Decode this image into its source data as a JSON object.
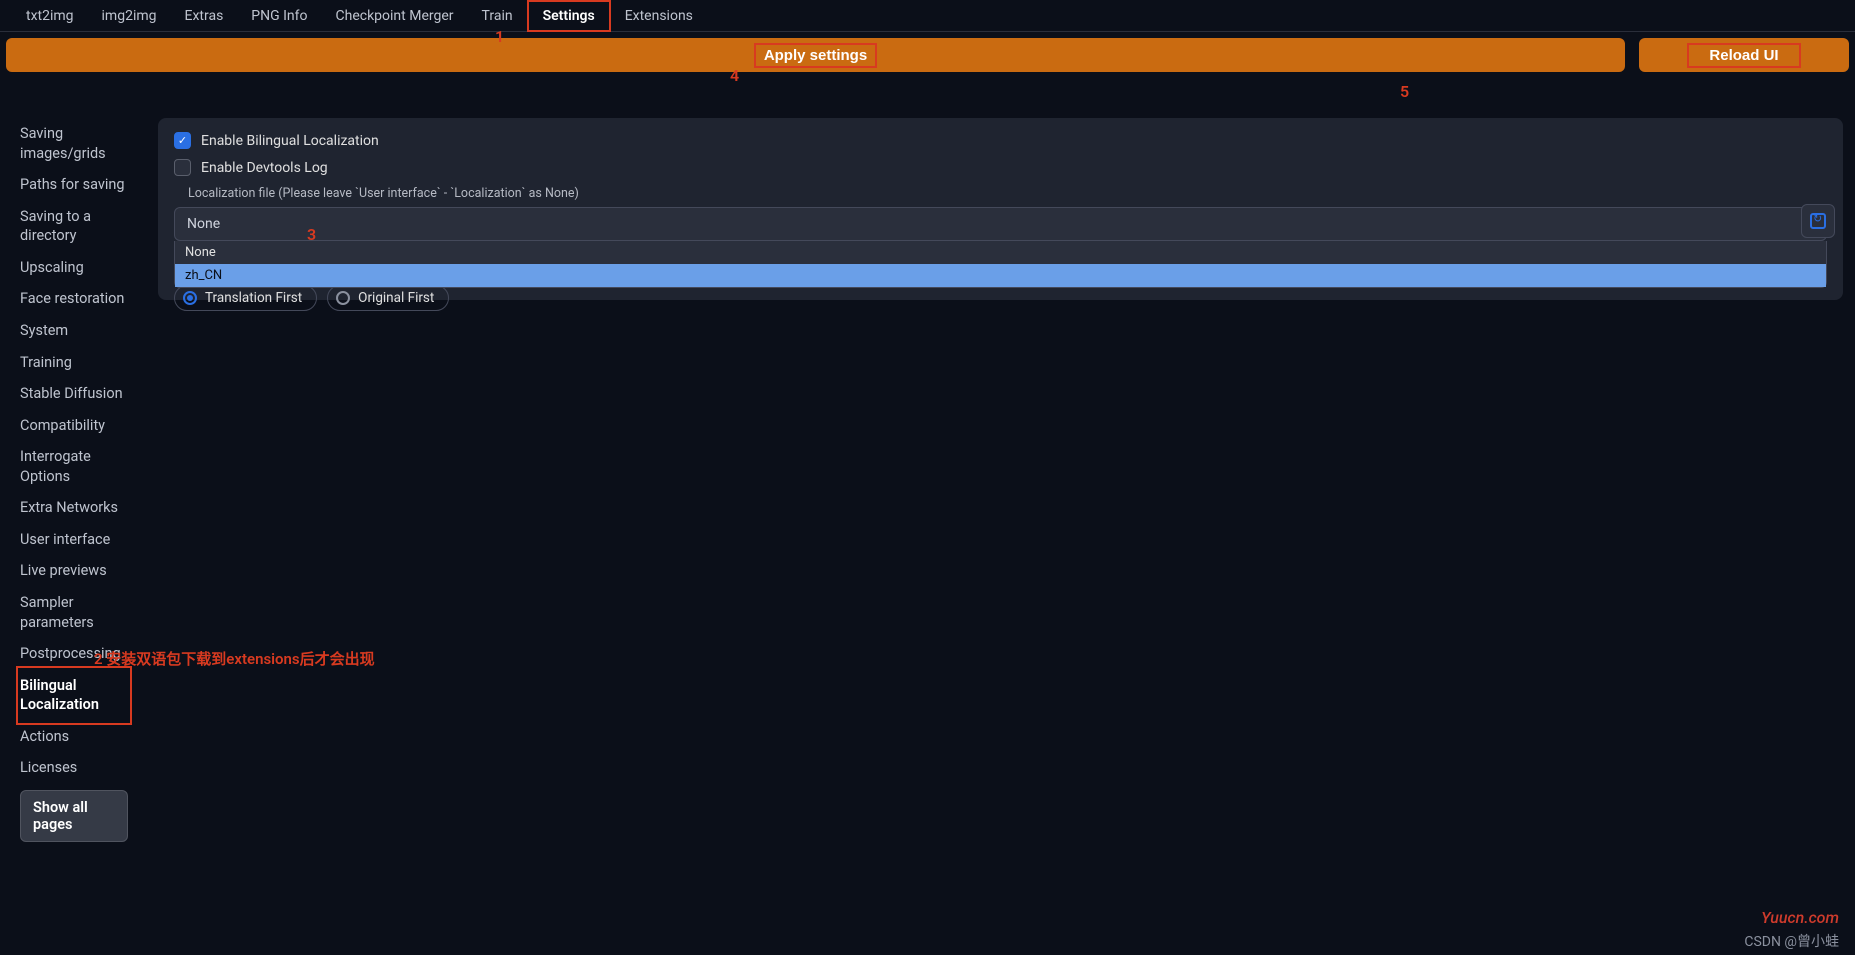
{
  "tabs": {
    "txt2img": "txt2img",
    "img2img": "img2img",
    "extras": "Extras",
    "pnginfo": "PNG Info",
    "checkpoint_merger": "Checkpoint Merger",
    "train": "Train",
    "settings": "Settings",
    "extensions": "Extensions"
  },
  "buttons": {
    "apply": "Apply settings",
    "reload": "Reload UI",
    "show_all": "Show all pages"
  },
  "sidebar": {
    "items": [
      "Saving images/grids",
      "Paths for saving",
      "Saving to a directory",
      "Upscaling",
      "Face restoration",
      "System",
      "Training",
      "Stable Diffusion",
      "Compatibility",
      "Interrogate Options",
      "Extra Networks",
      "User interface",
      "Live previews",
      "Sampler parameters",
      "Postprocessing",
      "Bilingual Localization",
      "Actions",
      "Licenses"
    ]
  },
  "settings": {
    "enable_bilingual": "Enable Bilingual Localization",
    "enable_devtools": "Enable Devtools Log",
    "loc_file_label": "Localization file (Please leave `User interface` - `Localization` as None)",
    "selected": "None",
    "options": {
      "none": "None",
      "zh_cn": "zh_CN"
    },
    "radio": {
      "translation_first": "Translation First",
      "original_first": "Original First"
    }
  },
  "annotations": {
    "n1": "1",
    "n2": "2 安装双语包下载到extensions后才会出现",
    "n3": "3",
    "n4": "4",
    "n5": "5"
  },
  "watermarks": {
    "w1": "Yuucn.com",
    "w2": "CSDN @曾小蛙"
  }
}
